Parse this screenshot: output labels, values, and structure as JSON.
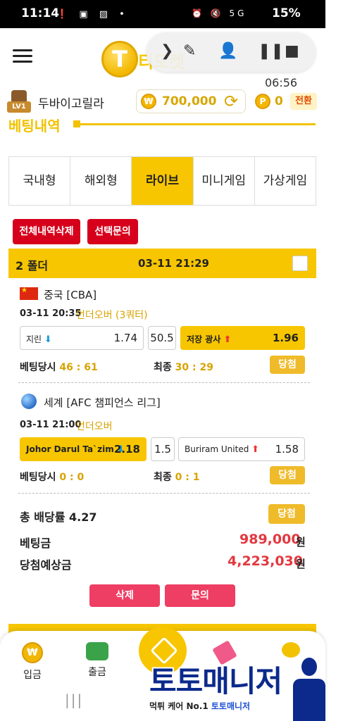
{
  "status_bar": {
    "time": "11:14",
    "left_icons": "❗ ▣ ▨ •",
    "right_icons": "⏰ 🔇 5G",
    "battery": "15%"
  },
  "header": {
    "logo_letter": "T",
    "logo_word": "티오켓"
  },
  "media": {
    "time": "06:56"
  },
  "user": {
    "level": "LV1",
    "name": "두바이고릴라",
    "money": "700,000",
    "point": "0",
    "convert_label": "전환"
  },
  "section": {
    "title": "베팅내역"
  },
  "tabs": [
    {
      "label": "국내형",
      "active": false
    },
    {
      "label": "해외형",
      "active": false
    },
    {
      "label": "라이브",
      "active": true
    },
    {
      "label": "미니게임",
      "active": false
    },
    {
      "label": "가상게임",
      "active": false
    }
  ],
  "actions": {
    "delete_all": "전체내역삭제",
    "inquiry_selected": "선택문의"
  },
  "folder": {
    "label": "2 폴더",
    "date": "03-11 21:29"
  },
  "games": [
    {
      "league": "중국 [CBA]",
      "datetime": "03-11 20:35",
      "market": "언더오버 (3쿼터)",
      "home": {
        "team": "지린",
        "odds": "1.74",
        "arrow": "down",
        "selected": false
      },
      "line": "50.5",
      "away": {
        "team": "저장 광사",
        "odds": "1.96",
        "arrow": "up",
        "selected": true
      },
      "bet_time_label": "베팅당시",
      "bet_time_score": "46 : 61",
      "final_label": "최종",
      "final_score": "30 : 29",
      "result": "당첨"
    },
    {
      "league": "세계 [AFC 챔피언스 리그]",
      "datetime": "03-11 21:00",
      "market": "언더오버",
      "home": {
        "team": "Johor Darul Ta`zim",
        "odds": "2.18",
        "arrow": "down",
        "selected": true
      },
      "line": "1.5",
      "away": {
        "team": "Buriram United",
        "odds": "1.58",
        "arrow": "up",
        "selected": false
      },
      "bet_time_label": "베팅당시",
      "bet_time_score": "0 : 0",
      "final_label": "최종",
      "final_score": "0 : 1",
      "result": "당첨"
    }
  ],
  "summary": {
    "total_odds_label": "총 배당률 4.27",
    "result": "당첨",
    "bet_amount_label": "베팅금",
    "bet_amount": "989,000",
    "expected_label": "당첨예상금",
    "expected_amount": "4,223,030",
    "unit": "원"
  },
  "buttons": {
    "delete": "삭제",
    "inquiry": "문의"
  },
  "bottom_nav": [
    {
      "label": "입금",
      "icon": "deposit-coin-icon"
    },
    {
      "label": "출금",
      "icon": "withdraw-money-icon"
    }
  ],
  "watermark": {
    "title": "토토매니저",
    "sub_a": "먹튀 케어 No.1 ",
    "sub_b": "토토매니저"
  },
  "colors": {
    "accent": "#f7c600",
    "red": "#d6001c",
    "pink": "#ee3e63",
    "win_gold": "#efbb2a"
  }
}
